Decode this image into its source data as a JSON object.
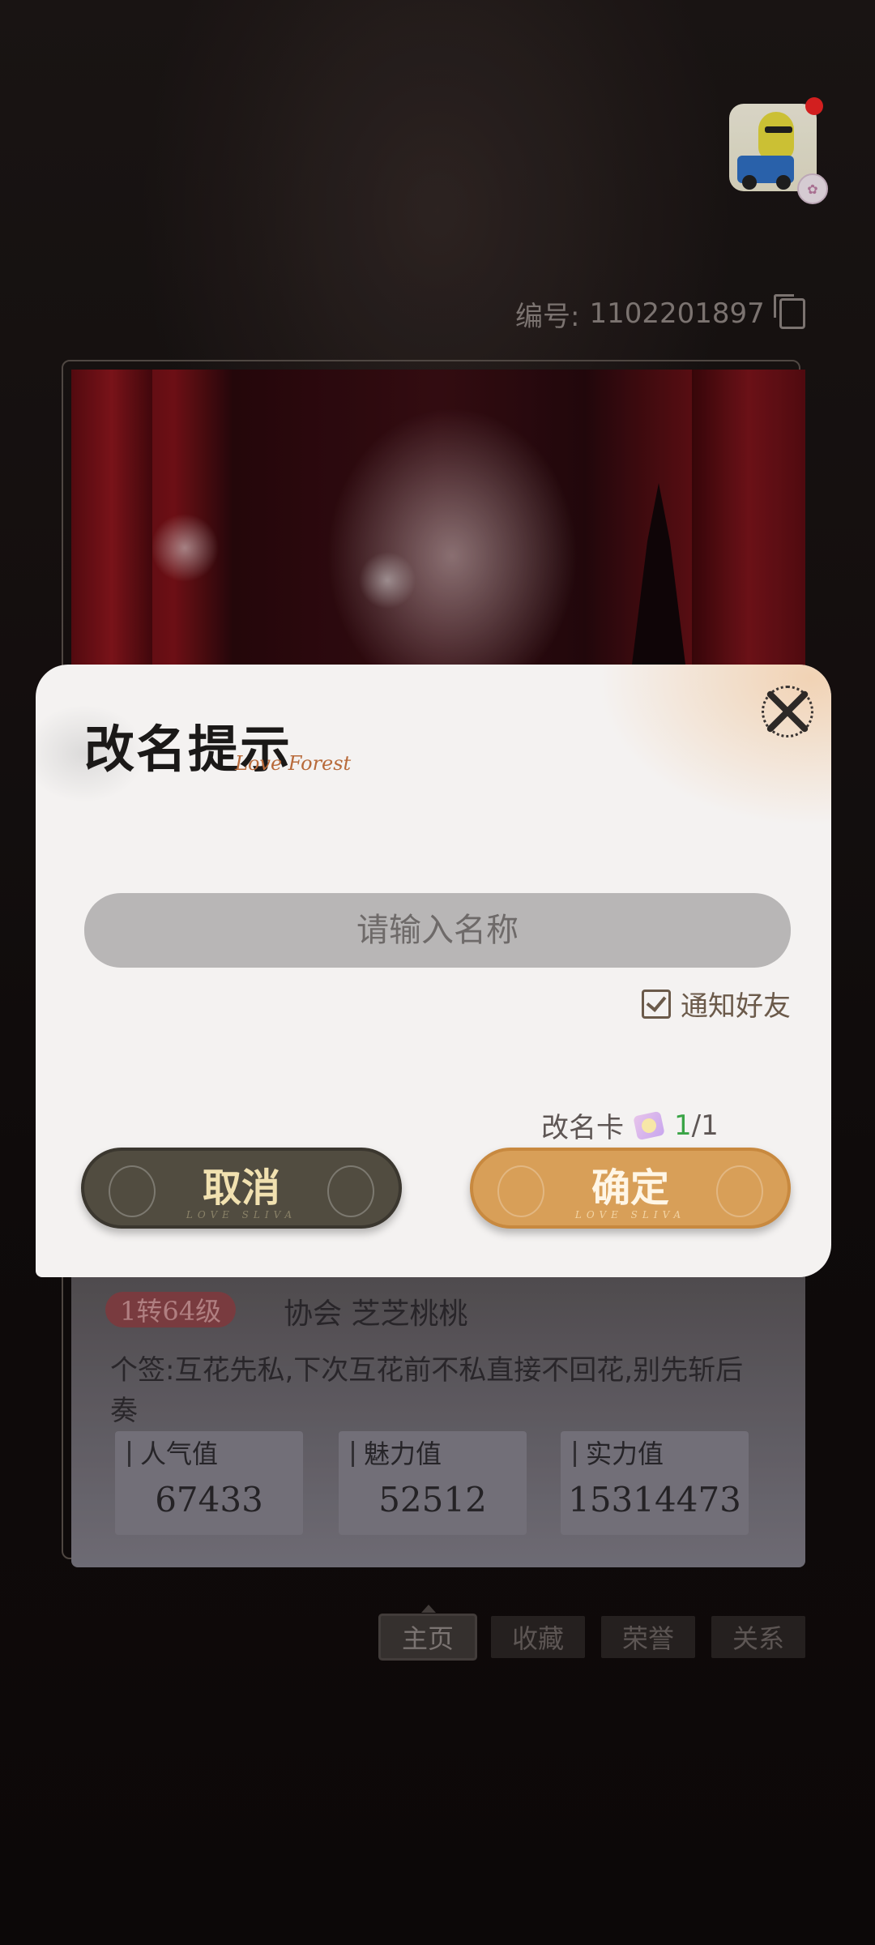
{
  "profile": {
    "id_label": "编号:",
    "id_value": "1102201897",
    "level": "1转64级",
    "guild": "协会 芝芝桃桃",
    "signature": "个签:互花先私,下次互花前不私直接不回花,别先斩后奏",
    "stats": [
      {
        "label": "人气值",
        "value": "67433"
      },
      {
        "label": "魅力值",
        "value": "52512"
      },
      {
        "label": "实力值",
        "value": "15314473"
      }
    ]
  },
  "tabs": [
    {
      "label": "主页",
      "active": true
    },
    {
      "label": "收藏",
      "active": false
    },
    {
      "label": "荣誉",
      "active": false
    },
    {
      "label": "关系",
      "active": false
    }
  ],
  "dialog": {
    "title": "改名提示",
    "script": "Love Forest",
    "input_placeholder": "请输入名称",
    "notify_label": "通知好友",
    "notify_checked": true,
    "rename_card_label": "改名卡",
    "card_current": "1",
    "card_total": "/1",
    "cancel_label": "取消",
    "cancel_sub": "LOVE SLIVA",
    "confirm_label": "确定",
    "confirm_sub": "LOVE SLIVA"
  },
  "icons": {
    "close": "close-icon",
    "copy": "copy-icon",
    "checkbox": "checkbox-icon",
    "rename_card": "rename-card-icon"
  },
  "colors": {
    "confirm": "#d89f58",
    "cancel": "#514c40",
    "card_count": "#3aa446",
    "notify_dot": "#ef2424"
  }
}
